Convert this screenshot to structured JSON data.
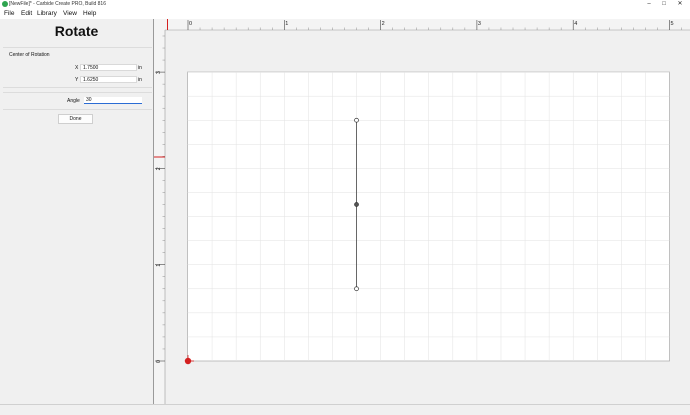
{
  "window": {
    "title": "[NewFile]* - Carbide Create PRO, Build 816",
    "minimize_glyph": "–",
    "maximize_glyph": "□",
    "close_glyph": "✕"
  },
  "menu": [
    "File",
    "Edit",
    "Library",
    "View",
    "Help"
  ],
  "panel": {
    "title": "Rotate",
    "center_label": "Center of Rotation",
    "x_label": "X",
    "x_value": "1.7500",
    "x_unit": "in",
    "y_label": "Y",
    "y_value": "1.6250",
    "y_unit": "in",
    "angle_label": "Angle",
    "angle_value": "30",
    "done_label": "Done"
  },
  "ruler": {
    "x_ticks": [
      "0",
      "1",
      "2",
      "3",
      "4",
      "5"
    ],
    "y_ticks": [
      "0",
      "1",
      "2",
      "3"
    ]
  },
  "canvas": {
    "x_range": [
      0,
      5
    ],
    "y_range": [
      0,
      3
    ],
    "grid_step": 0.25,
    "line": {
      "x": 1.75,
      "y_start": 0.75,
      "y_end": 2.5,
      "center_y": 1.625
    },
    "accent_color": "#d42020"
  }
}
